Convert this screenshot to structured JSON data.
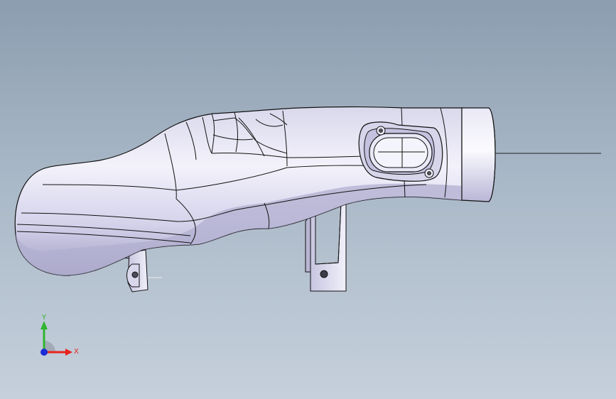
{
  "viewport": {
    "background_top": "#8c9db0",
    "background_bottom": "#c6d0dc",
    "model_name": "",
    "model_fill": "#e4e3f2",
    "model_shadow": "#a9a6c6",
    "edge_color": "#111111"
  },
  "triad": {
    "x_label": "X",
    "y_label": "Y",
    "x_color": "#e8231e",
    "y_color": "#2fb52f",
    "z_color": "#1c2cd6"
  }
}
